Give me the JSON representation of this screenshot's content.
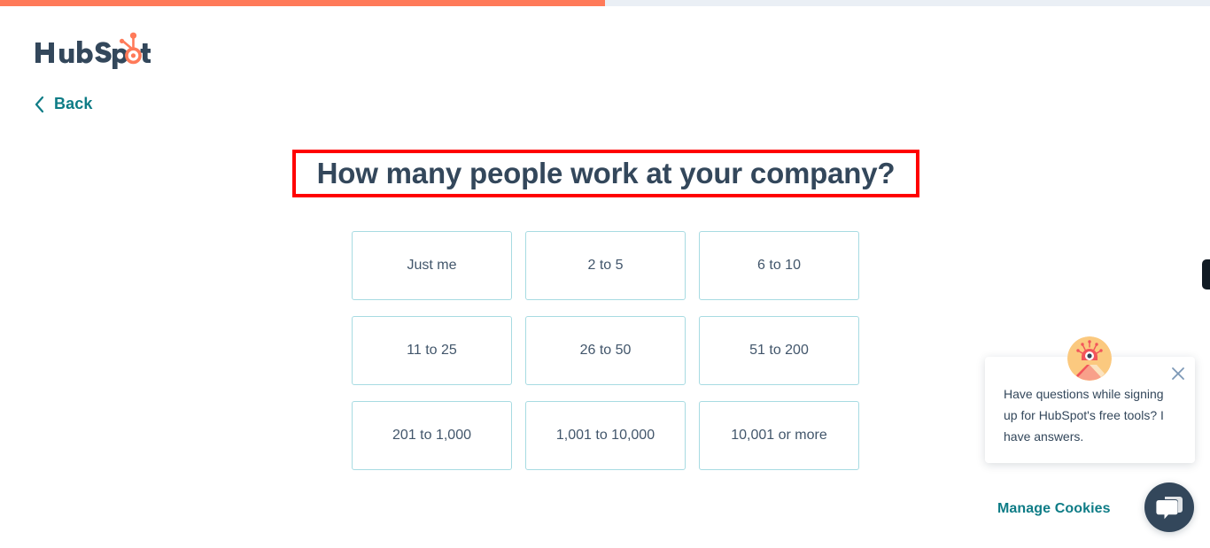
{
  "brand": {
    "logo_text": "HubSpot",
    "logo_navy": "#33475b",
    "logo_orange": "#ff7a59"
  },
  "progress": {
    "percent": 50,
    "fill_color": "#ff7a59",
    "track_color": "#eaeff5"
  },
  "nav": {
    "back_label": "Back",
    "back_icon": "chevron-left-icon",
    "link_color": "#0e7c86"
  },
  "main": {
    "heading": "How many people work at your company?",
    "heading_color": "#33475b",
    "annotation_color": "#ff0000",
    "options": [
      "Just me",
      "2 to 5",
      "6 to 10",
      "11 to 25",
      "26 to 50",
      "51 to 200",
      "201 to 1,000",
      "1,001 to 10,000",
      "10,001 or more"
    ],
    "option_border_color": "#a7dbe2"
  },
  "chat": {
    "avatar_icon": "robot-avatar-icon",
    "close_icon": "close-icon",
    "message": "Have questions while signing up for HubSpot's free tools? I have answers.",
    "launcher_icon": "chat-bubbles-icon",
    "launcher_color": "#33475b"
  },
  "footer": {
    "manage_cookies_label": "Manage Cookies",
    "link_color": "#0e7c86"
  }
}
